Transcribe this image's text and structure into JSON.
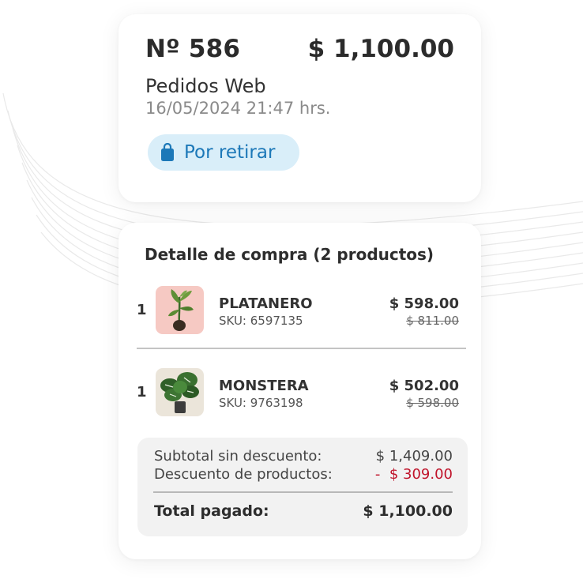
{
  "order": {
    "number": "Nº 586",
    "total": "$ 1,100.00",
    "channel": "Pedidos Web",
    "datetime": "16/05/2024 21:47 hrs.",
    "status": {
      "label": "Por retirar",
      "icon": "shopping-bag-icon"
    }
  },
  "detail": {
    "title": "Detalle de compra (2 productos)",
    "products": [
      {
        "qty": "1",
        "name": "PLATANERO",
        "sku": "SKU: 6597135",
        "price": "$ 598.00",
        "original_price": "$ 811.00",
        "image": "banana-plant-image"
      },
      {
        "qty": "1",
        "name": "MONSTERA",
        "sku": "SKU: 9763198",
        "price": "$ 502.00",
        "original_price": "$ 598.00",
        "image": "monstera-plant-image"
      }
    ],
    "summary": {
      "subtotal_label": "Subtotal sin descuento:",
      "subtotal_value": "$ 1,409.00",
      "discount_label": "Descuento de productos:",
      "discount_value": "-  $ 309.00",
      "total_label": "Total pagado:",
      "total_value": "$ 1,100.00"
    }
  },
  "colors": {
    "status_pill_bg": "#d9eef9",
    "status_accent": "#1c78b8",
    "discount": "#c0142b"
  }
}
